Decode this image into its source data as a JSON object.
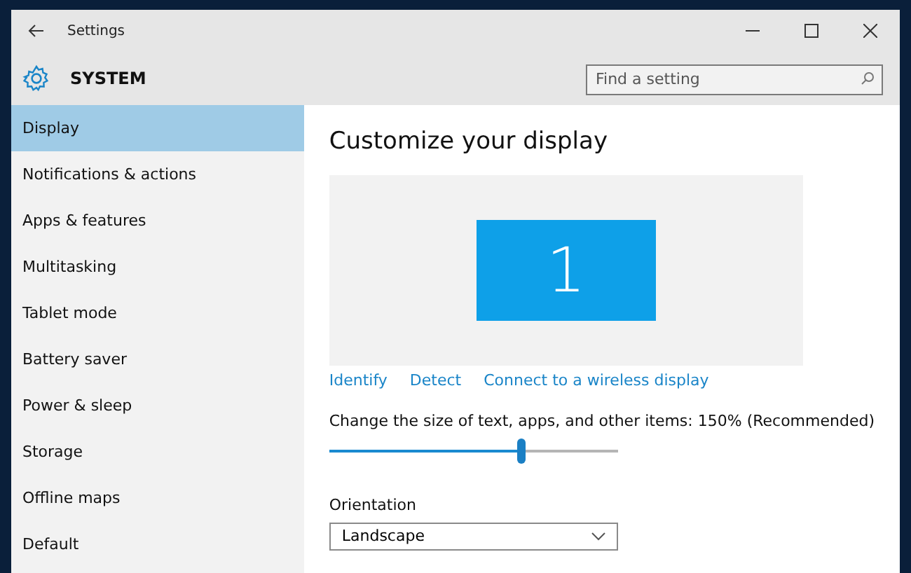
{
  "window": {
    "title": "Settings"
  },
  "header": {
    "title": "SYSTEM",
    "search": {
      "placeholder": "Find a setting"
    }
  },
  "sidebar": {
    "items": [
      {
        "label": "Display",
        "selected": true
      },
      {
        "label": "Notifications & actions",
        "selected": false
      },
      {
        "label": "Apps & features",
        "selected": false
      },
      {
        "label": "Multitasking",
        "selected": false
      },
      {
        "label": "Tablet mode",
        "selected": false
      },
      {
        "label": "Battery saver",
        "selected": false
      },
      {
        "label": "Power & sleep",
        "selected": false
      },
      {
        "label": "Storage",
        "selected": false
      },
      {
        "label": "Offline maps",
        "selected": false
      },
      {
        "label": "Default",
        "selected": false
      }
    ]
  },
  "content": {
    "title": "Customize your display",
    "monitor": "1",
    "links": [
      "Identify",
      "Detect",
      "Connect to a wireless display"
    ],
    "scale": {
      "label": "Change the size of text, apps, and other items: 150% (Recommended)",
      "level": 0.665
    },
    "orientation": {
      "label": "Orientation",
      "value": "Landscape"
    }
  }
}
